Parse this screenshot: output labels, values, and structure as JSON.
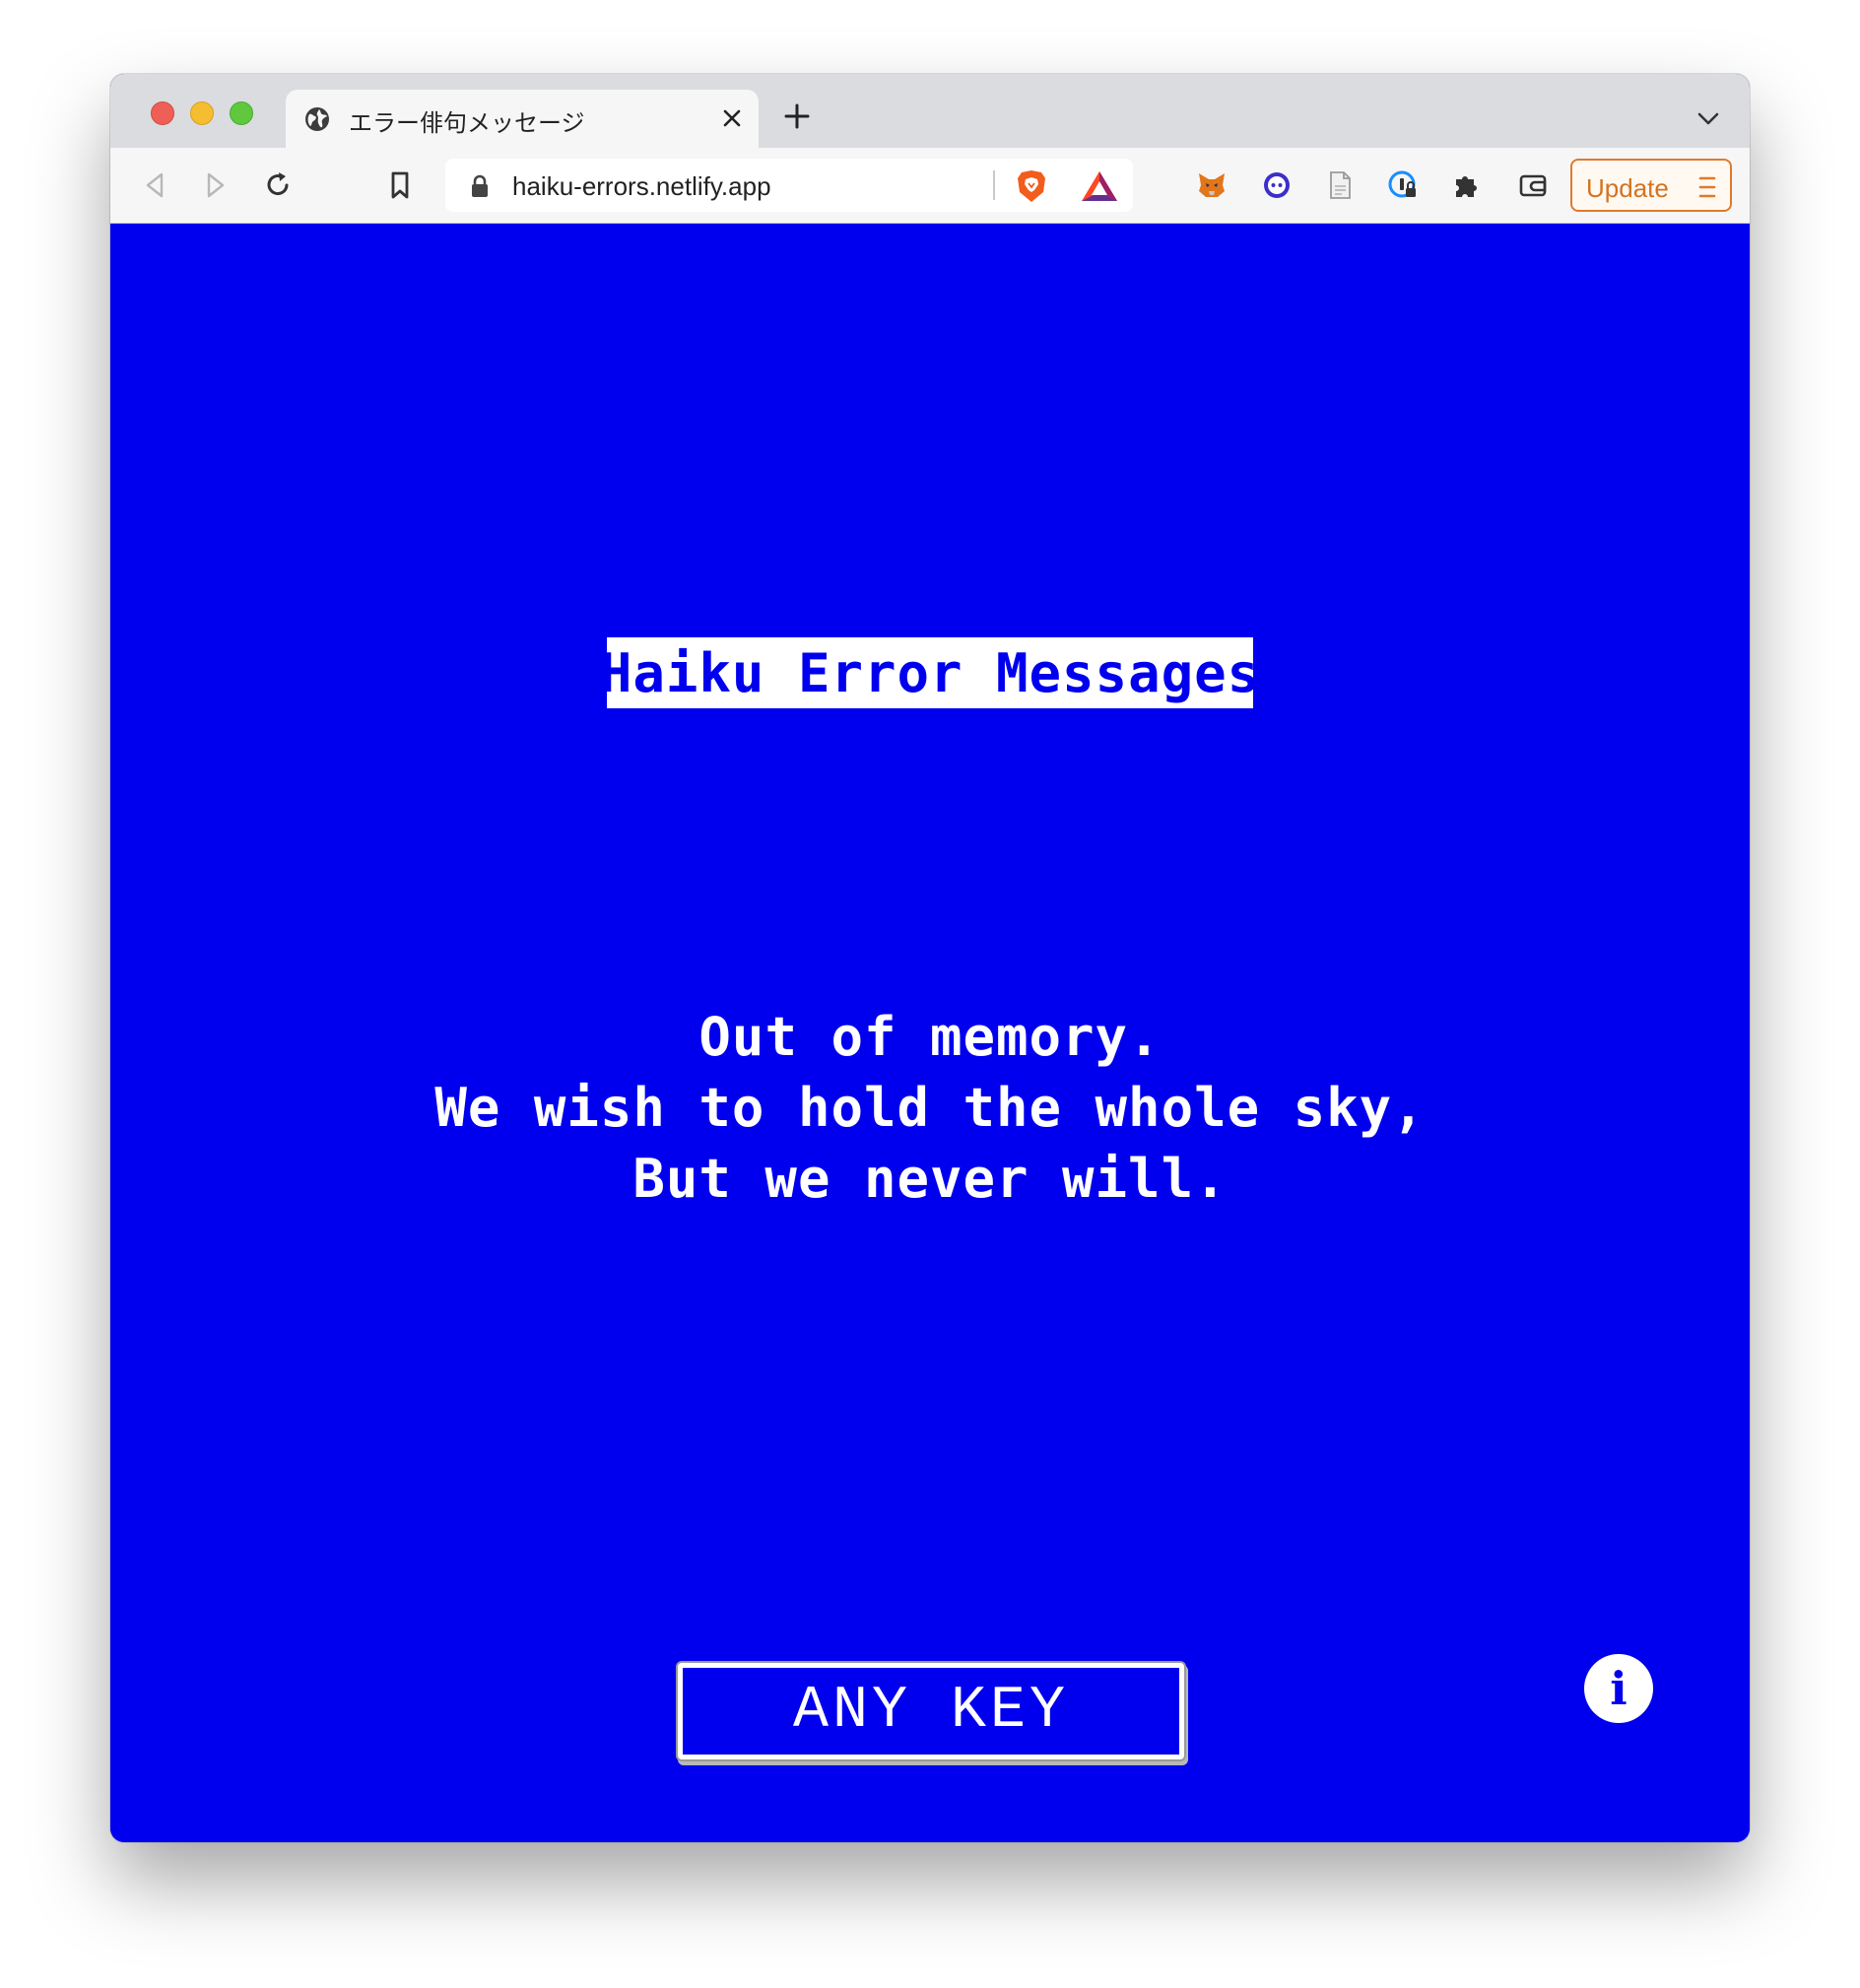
{
  "browser": {
    "tab": {
      "title": "エラー俳句メッセージ",
      "icon": "globe-icon"
    },
    "url": "haiku-errors.netlify.app",
    "update_label": "Update",
    "accent_color": "#d4731f"
  },
  "page": {
    "background_color": "#0000ee",
    "heading": "Haiku Error Messages",
    "haiku": [
      "Out of memory.",
      "We wish to hold the whole sky,",
      "But we never will."
    ],
    "any_key_label": "ANY KEY",
    "info_label": "i"
  }
}
